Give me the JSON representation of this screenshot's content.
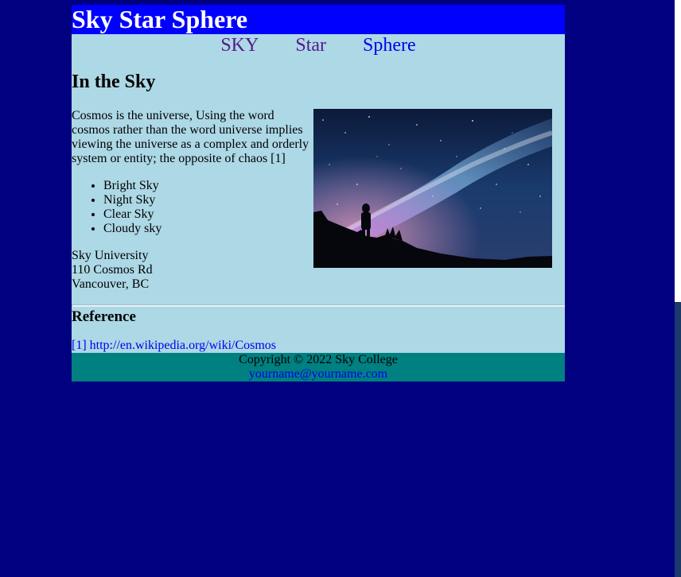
{
  "header": {
    "title": "Sky Star Sphere"
  },
  "nav": {
    "items": [
      {
        "label": "SKY"
      },
      {
        "label": "Star"
      },
      {
        "label": "Sphere"
      }
    ]
  },
  "main": {
    "heading": "In the Sky",
    "intro": "Cosmos is the universe, Using the word cosmos rather than the word universe implies viewing the universe as a complex and orderly system or entity; the opposite of chaos [1]",
    "list": [
      "Bright Sky",
      "Night Sky",
      "Clear Sky",
      "Cloudy sky"
    ],
    "address": {
      "line1": "Sky University",
      "line2": "110 Cosmos Rd",
      "line3": "Vancouver, BC"
    },
    "image_icon": "milky-way-photo"
  },
  "reference": {
    "heading": "Reference",
    "link_marker": "[1]",
    "link_url": "http://en.wikipedia.org/wiki/Cosmos"
  },
  "footer": {
    "copyright": "Copyright © 2022 Sky College",
    "email": "yourname@yourname.com"
  },
  "colors": {
    "page_bg": "#000080",
    "header_bg": "#0000ff",
    "content_bg": "#add8e6",
    "footer_bg": "#008080",
    "link": "#0000ee",
    "visited_link": "#551a8b"
  }
}
